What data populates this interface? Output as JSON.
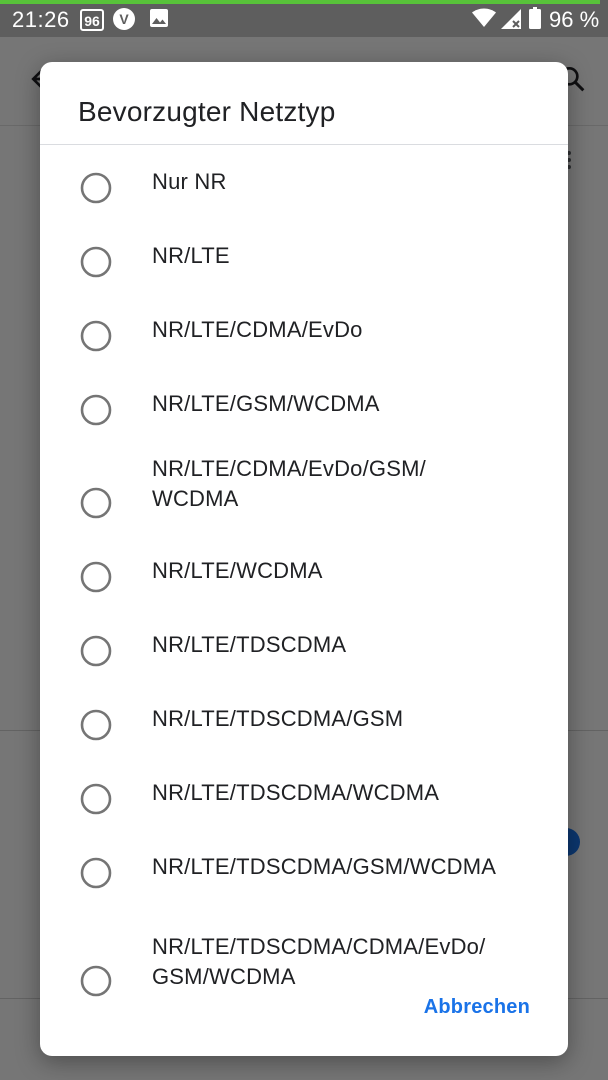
{
  "status_bar": {
    "time": "21:26",
    "badge": "96",
    "vpn_letter": "V",
    "battery": "96 %",
    "icons": [
      "badge-96-icon",
      "v-icon",
      "image-icon",
      "wifi-icon",
      "signal-icon",
      "battery-icon"
    ]
  },
  "dialog": {
    "title": "Bevorzugter Netztyp",
    "options": [
      {
        "label": "Nur NR",
        "selected": false
      },
      {
        "label": "NR/LTE",
        "selected": false
      },
      {
        "label": "NR/LTE/CDMA/EvDo",
        "selected": false
      },
      {
        "label": "NR/LTE/GSM/WCDMA",
        "selected": false
      },
      {
        "label": "NR/LTE/CDMA/EvDo/GSM/\nWCDMA",
        "selected": false
      },
      {
        "label": "NR/LTE/WCDMA",
        "selected": false
      },
      {
        "label": "NR/LTE/TDSCDMA",
        "selected": false
      },
      {
        "label": "NR/LTE/TDSCDMA/GSM",
        "selected": false
      },
      {
        "label": "NR/LTE/TDSCDMA/WCDMA",
        "selected": false
      },
      {
        "label": "NR/LTE/TDSCDMA/GSM/WCDMA",
        "selected": false
      },
      {
        "label": "NR/LTE/TDSCDMA/CDMA/EvDo/\nGSM/WCDMA",
        "selected": false
      }
    ],
    "cancel_label": "Abbrechen"
  },
  "colors": {
    "accent": "#1a73e8",
    "status_progress": "#58c23a",
    "radio_outline": "#757575"
  }
}
